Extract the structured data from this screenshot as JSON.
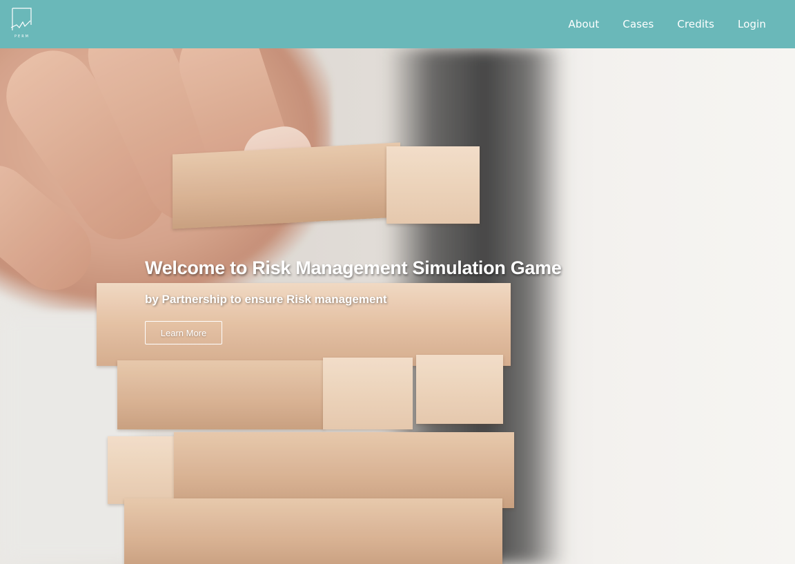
{
  "header": {
    "logo_text": "PERM",
    "logo_icon": "perm-logo-icon",
    "background_color": "#6ab8b9",
    "nav": [
      {
        "label": "About"
      },
      {
        "label": "Cases"
      },
      {
        "label": "Credits"
      },
      {
        "label": "Login"
      }
    ]
  },
  "hero": {
    "title": "Welcome to Risk Management Simulation Game",
    "subtitle": "by Partnership to ensure Risk management",
    "cta_label": "Learn More",
    "image": "hand-stacking-wooden-blocks"
  }
}
